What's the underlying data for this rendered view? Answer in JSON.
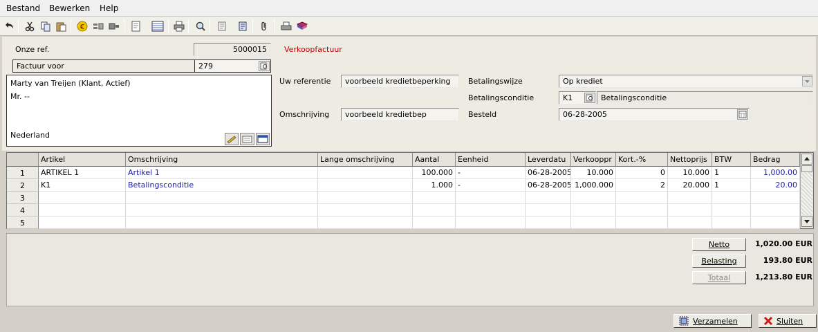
{
  "menu": [
    {
      "label": "Bestand"
    },
    {
      "label": "Bewerken"
    },
    {
      "label": "Help"
    }
  ],
  "form": {
    "onze_ref_label": "Onze ref.",
    "onze_ref_value": "5000015",
    "doc_type": "Verkoopfactuur",
    "factuur_voor_label": "Factuur voor",
    "factuur_voor_value": "279",
    "address_line1": "Marty van Treijen (Klant, Actief)",
    "address_line2": "Mr. --",
    "address_country": "Nederland",
    "uw_referentie_label": "Uw referentie",
    "uw_referentie_value": "voorbeeld kredietbeperking",
    "omschrijving_label": "Omschrijving",
    "omschrijving_value": "voorbeeld kredietbep",
    "betalingswijze_label": "Betalingswijze",
    "betalingswijze_value": "Op krediet",
    "betalingsconditie_label": "Betalingsconditie",
    "betalingsconditie_code": "K1",
    "betalingsconditie_desc": "Betalingsconditie",
    "besteld_label": "Besteld",
    "besteld_value": "06-28-2005"
  },
  "grid": {
    "columns": [
      "Artikel",
      "Omschrijving",
      "Lange omschrijving",
      "Aantal",
      "Eenheid",
      "Leverdatu",
      "Verkooppr",
      "Kort.-%",
      "Nettoprijs",
      "BTW",
      "Bedrag"
    ],
    "row_numbers": [
      "1",
      "2",
      "3",
      "4",
      "5"
    ],
    "rows": [
      [
        "ARTIKEL 1",
        "Artikel 1",
        "",
        "100.000",
        "-",
        "06-28-2005",
        "10.000",
        "0",
        "10.000",
        "1",
        "1,000.00"
      ],
      [
        "K1",
        "Betalingsconditie",
        "",
        "1.000",
        "-",
        "06-28-2005",
        "1,000.000",
        "2",
        "20.000",
        "1",
        "20.00"
      ]
    ]
  },
  "summary": {
    "netto_label": "Netto",
    "netto_value": "1,020.00 EUR",
    "belasting_label": "Belasting",
    "belasting_value": "193.80 EUR",
    "totaal_label": "Totaal",
    "totaal_value": "1,213.80 EUR"
  },
  "footer": {
    "verzamelen_label": "Verzamelen",
    "sluiten_label": "Sluiten"
  },
  "colors": {
    "accent_red": "#c00000",
    "link_blue": "#1a1aa8"
  }
}
